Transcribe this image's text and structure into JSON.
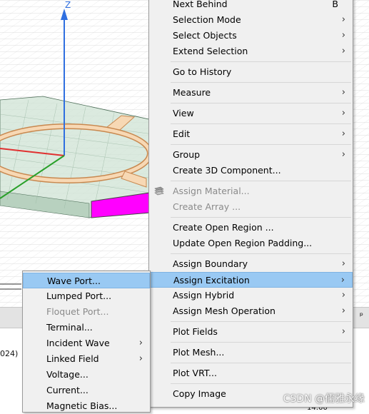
{
  "viewport": {
    "axis_label": "Z",
    "feature_color": "#ff00ff"
  },
  "context_menu": {
    "items": [
      {
        "label": "Next Behind",
        "shortcut": "B"
      },
      {
        "label": "Selection Mode"
      },
      {
        "label": "Select Objects"
      },
      {
        "label": "Extend Selection"
      },
      {
        "label": "Go to History"
      },
      {
        "label": "Measure"
      },
      {
        "label": "View"
      },
      {
        "label": "Edit"
      },
      {
        "label": "Group"
      },
      {
        "label": "Create 3D Component..."
      },
      {
        "label": "Assign Material..."
      },
      {
        "label": "Create Array ..."
      },
      {
        "label": "Create Open Region ..."
      },
      {
        "label": "Update Open Region Padding..."
      },
      {
        "label": "Assign Boundary"
      },
      {
        "label": "Assign Excitation"
      },
      {
        "label": "Assign Hybrid"
      },
      {
        "label": "Assign Mesh Operation"
      },
      {
        "label": "Plot Fields"
      },
      {
        "label": "Plot Mesh..."
      },
      {
        "label": "Plot VRT..."
      },
      {
        "label": "Copy Image"
      }
    ]
  },
  "submenu": {
    "items": [
      {
        "label": "Wave Port..."
      },
      {
        "label": "Lumped Port..."
      },
      {
        "label": "Floquet Port..."
      },
      {
        "label": "Terminal..."
      },
      {
        "label": "Incident Wave"
      },
      {
        "label": "Linked Field"
      },
      {
        "label": "Voltage..."
      },
      {
        "label": "Current..."
      },
      {
        "label": "Magnetic Bias..."
      }
    ]
  },
  "background": {
    "partial_text": "024)",
    "pin_glyph": "ᵖ",
    "clock": "14:00"
  },
  "watermark": "CSDN @儒雅永缘"
}
